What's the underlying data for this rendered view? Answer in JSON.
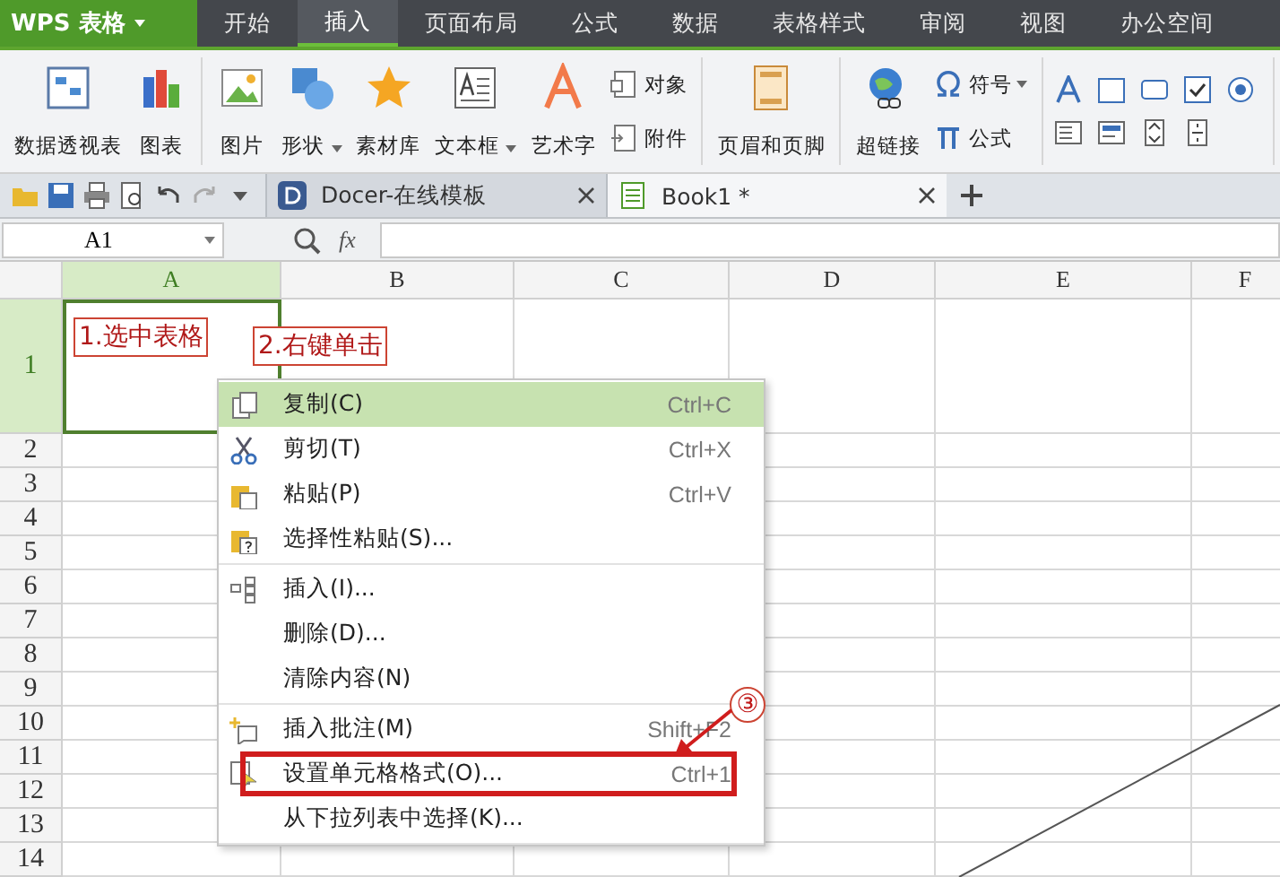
{
  "app_menu": {
    "label": "WPS 表格"
  },
  "menu_tabs": [
    {
      "label": "开始",
      "selected": false
    },
    {
      "label": "插入",
      "selected": true
    },
    {
      "label": "页面布局",
      "selected": false
    },
    {
      "label": "公式",
      "selected": false
    },
    {
      "label": "数据",
      "selected": false
    },
    {
      "label": "表格样式",
      "selected": false
    },
    {
      "label": "审阅",
      "selected": false
    },
    {
      "label": "视图",
      "selected": false
    },
    {
      "label": "办公空间",
      "selected": false
    }
  ],
  "ribbon": {
    "groups": [
      {
        "items": [
          {
            "kind": "large",
            "label": "数据透视表",
            "dropdown": false
          },
          {
            "kind": "large",
            "label": "图表",
            "dropdown": false
          }
        ]
      },
      {
        "items": [
          {
            "kind": "large",
            "label": "图片",
            "dropdown": false
          },
          {
            "kind": "large",
            "label": "形状",
            "dropdown": true
          },
          {
            "kind": "large",
            "label": "素材库",
            "dropdown": false
          },
          {
            "kind": "large",
            "label": "文本框",
            "dropdown": true
          },
          {
            "kind": "large",
            "label": "艺术字",
            "dropdown": false
          },
          {
            "kind": "small",
            "label": "对象",
            "dropdown": false
          },
          {
            "kind": "small",
            "label": "附件",
            "dropdown": false
          }
        ]
      },
      {
        "items": [
          {
            "kind": "large",
            "label": "页眉和页脚",
            "dropdown": false
          }
        ]
      },
      {
        "items": [
          {
            "kind": "large",
            "label": "超链接",
            "dropdown": false
          },
          {
            "kind": "small",
            "label": "符号",
            "dropdown": true
          },
          {
            "kind": "small",
            "label": "公式",
            "dropdown": false
          }
        ]
      },
      {
        "items": [
          {
            "kind": "icons"
          }
        ]
      }
    ]
  },
  "doc_tabs": [
    {
      "label": "Docer-在线模板",
      "selected": false
    },
    {
      "label": "Book1 *",
      "selected": true
    }
  ],
  "formula_bar": {
    "cell_ref": "A1",
    "function_label": "fx"
  },
  "sheet": {
    "columns": [
      {
        "label": "A",
        "selected": true
      },
      {
        "label": "B",
        "selected": false
      },
      {
        "label": "C",
        "selected": false
      },
      {
        "label": "D",
        "selected": false
      },
      {
        "label": "E",
        "selected": false
      },
      {
        "label": "F",
        "selected": false
      }
    ],
    "rows": [
      {
        "label": "1",
        "selected": true
      },
      {
        "label": "2",
        "selected": false
      },
      {
        "label": "3",
        "selected": false
      },
      {
        "label": "4",
        "selected": false
      },
      {
        "label": "5",
        "selected": false
      },
      {
        "label": "6",
        "selected": false
      },
      {
        "label": "7",
        "selected": false
      },
      {
        "label": "8",
        "selected": false
      },
      {
        "label": "9",
        "selected": false
      },
      {
        "label": "10",
        "selected": false
      },
      {
        "label": "11",
        "selected": false
      },
      {
        "label": "12",
        "selected": false
      },
      {
        "label": "13",
        "selected": false
      },
      {
        "label": "14",
        "selected": false
      }
    ]
  },
  "annotations": [
    {
      "kind": "label",
      "text": "1.选中表格"
    },
    {
      "kind": "label",
      "text": "2.右键单击"
    },
    {
      "kind": "step",
      "text": "③"
    }
  ],
  "context_menu": {
    "sections": [
      [
        {
          "label": "复制(C)",
          "shortcut": "Ctrl+C",
          "selected": true,
          "marked": false
        },
        {
          "label": "剪切(T)",
          "shortcut": "Ctrl+X",
          "selected": false,
          "marked": false
        },
        {
          "label": "粘贴(P)",
          "shortcut": "Ctrl+V",
          "selected": false,
          "marked": false
        },
        {
          "label": "选择性粘贴(S)...",
          "selected": false,
          "marked": false
        }
      ],
      [
        {
          "label": "插入(I)...",
          "selected": false,
          "marked": false
        },
        {
          "label": "删除(D)...",
          "selected": false,
          "marked": false
        },
        {
          "label": "清除内容(N)",
          "selected": false,
          "marked": false
        }
      ],
      [
        {
          "label": "插入批注(M)",
          "shortcut": "Shift+F2",
          "selected": false,
          "marked": false
        },
        {
          "label": "设置单元格格式(O)...",
          "shortcut": "Ctrl+1",
          "selected": false,
          "marked": true
        },
        {
          "label": "从下拉列表中选择(K)...",
          "selected": false,
          "marked": false
        }
      ]
    ]
  }
}
